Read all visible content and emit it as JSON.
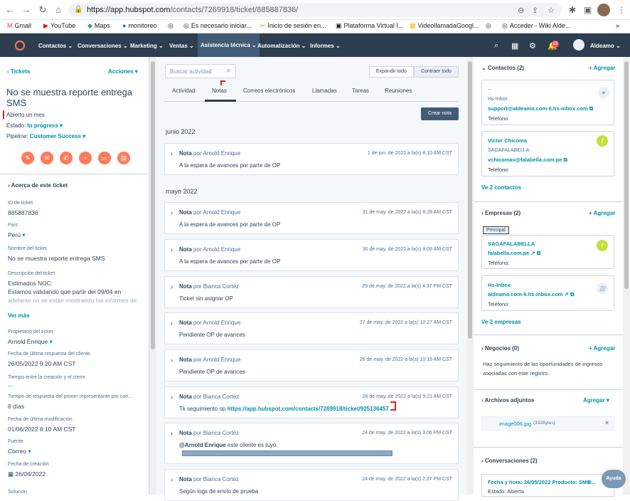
{
  "browser": {
    "url_host": "https://app.hubspot.com",
    "url_path": "/contacts/7269918/ticket/885887836/",
    "bookmarks": [
      {
        "label": "Gmail",
        "icon": "M"
      },
      {
        "label": "YouTube",
        "icon": "▶"
      },
      {
        "label": "Maps",
        "icon": "◆"
      },
      {
        "label": "monitoreo",
        "icon": "●"
      },
      {
        "label": "",
        "icon": "◎"
      },
      {
        "label": "Es necesario iniciar...",
        "icon": "◎"
      },
      {
        "label": "Inicio de sesión en...",
        "icon": "✂"
      },
      {
        "label": "Plataforma Virtual I...",
        "icon": "▣"
      },
      {
        "label": "VideollamadaGoogl...",
        "icon": "▦"
      },
      {
        "label": "",
        "icon": "◎"
      },
      {
        "label": "Acceder - Wiki Alde...",
        "icon": "◎"
      }
    ]
  },
  "nav": {
    "items": [
      "Contactos",
      "Conversaciones",
      "Marketing",
      "Ventas",
      "Asistencia técnica",
      "Automatización",
      "Informes"
    ],
    "notif_count": "23",
    "user": "Aldeamo"
  },
  "left": {
    "back": "Tickets",
    "actions": "Acciones",
    "title": "No se muestra reporte entrega SMS",
    "opened": "Abierto un mes",
    "estado_label": "Estado:",
    "estado_value": "In progress",
    "pipeline_label": "Pipeline:",
    "pipeline_value": "Customer Success",
    "about": "Acerca de este ticket",
    "props": [
      {
        "label": "ID de ticket",
        "value": "885887836"
      },
      {
        "label": "País",
        "value": "Perú"
      },
      {
        "label": "Nombre del ticket",
        "value": "No se muestra reporte entrega SMS"
      },
      {
        "label": "Descripción del ticket",
        "value": "Estimados NOC:"
      },
      {
        "label": "Propietario del ticket",
        "value": "Arnold Enrique"
      },
      {
        "label": "Fecha de última respuesta del cliente",
        "value": "26/05/2022 9:20 AM CST"
      },
      {
        "label": "Tiempo entre la creación y el cierre",
        "value": "--"
      },
      {
        "label": "Tiempo de respuesta del primer representante por corr...",
        "value": "8 días"
      },
      {
        "label": "Fecha de última modificación",
        "value": "01/06/2022 8:10 AM CST"
      },
      {
        "label": "Fuente",
        "value": "Correo"
      },
      {
        "label": "Fecha de creación",
        "value": "26/04/2022"
      },
      {
        "label": "Solución",
        "value": ""
      }
    ],
    "desc_line2": "Estamos validando que partir del 09/04 en",
    "desc_line3": "adelante no se están mostrando los informes de",
    "ver_mas": "Ver más"
  },
  "mid": {
    "search_placeholder": "Buscar actividad",
    "expand": "Expandir todo",
    "collapse": "Contraer todo",
    "tabs": [
      "Actividad",
      "Notas",
      "Correos electrónicos",
      "Llamadas",
      "Tareas",
      "Reuniones"
    ],
    "crear_nota": "Crear nota",
    "month1": "junio 2022",
    "month2": "mayo 2022",
    "note_word": "Nota",
    "notes": [
      {
        "author": "por Arnold Enrique",
        "date": "1 de jun. de 2022 a la(s) 8:10 AM CST",
        "body": "A la espera de avances por parte de OP"
      },
      {
        "author": "por Arnold Enrique",
        "date": "31 de may. de 2022 a la(s) 8:39 AM CST",
        "body": "A la espera de avances por parte de OP"
      },
      {
        "author": "por Arnold Enrique",
        "date": "30 de may. de 2022 a la(s) 8:09 AM CST",
        "body": "A la espera de avances por parte de OP"
      },
      {
        "author": "por Bianca Cortéz",
        "date": "29 de may. de 2022 a la(s) 4:37 PM CST",
        "body": "Ticket sin asignar OP"
      },
      {
        "author": "por Arnold Enrique",
        "date": "27 de may. de 2022 a la(s) 10:27 AM CST",
        "body": "Pendiente OP de avances"
      },
      {
        "author": "por Arnold Enrique",
        "date": "26 de may. de 2022 a la(s) 10:15 AM CST",
        "body": "Pendiente OP de avances"
      },
      {
        "author": "por Bianca Cortéz",
        "date": "26 de may. de 2022 a la(s) 9:21 AM CST",
        "body": "Tk seguimiento op ",
        "link": "https://app.hubspot.com/contacts/7269918/ticket/925136457"
      },
      {
        "author": "por Bianca Cortéz",
        "date": "24 de may. de 2022 a la(s) 3:06 PM CST",
        "mention": "@Arnold Enrique",
        "body": " este cliente es tuyo"
      },
      {
        "author": "por Bianca Cortéz",
        "date": "24 de may. de 2022 a la(s) 2:27 PM CST",
        "body": "Según logs de envío de prueba"
      }
    ]
  },
  "right": {
    "contactos": "Contactos (2)",
    "agregar": "+ Agregar",
    "c1_line1": "--",
    "c1_company": "Hs-Inbox",
    "c1_email": "support@aldeamo.com-6.hs-inbox.com",
    "telefono": "Teléfono:",
    "c2_name": "Victor Chicoma",
    "c2_company": "SAGAFALABELLA",
    "c2_email": "vchicomav@falabella.com.pe",
    "ver_contactos": "Ve 2 contactos",
    "empresas": "Empresas (2)",
    "principal": "Principal",
    "e1_name": "SAGAFALABELLA",
    "e1_domain": "falabella.com.pe",
    "e2_name": "Hs-Inbox",
    "e2_domain": "aldeamo.com-6.hs-inbox.com",
    "ver_empresas": "Ve 2 empresas",
    "negocios": "Negocios (0)",
    "negocios_text1": "Haz seguimiento de las oportunidades de ingresos",
    "negocios_text2": "asociadas con este registro.",
    "archivos": "Archivos adjuntos",
    "agregar2": "Agregar",
    "file_name": "image006.jpg",
    "file_size": "(3328ytes)",
    "conversaciones": "Conversaciones (2)",
    "conv_title": "Fecha y hora: 26/05/2022 Producto: SMS ...",
    "conv_status": "Estado: Abierta",
    "ayuda": "Ayuda"
  }
}
